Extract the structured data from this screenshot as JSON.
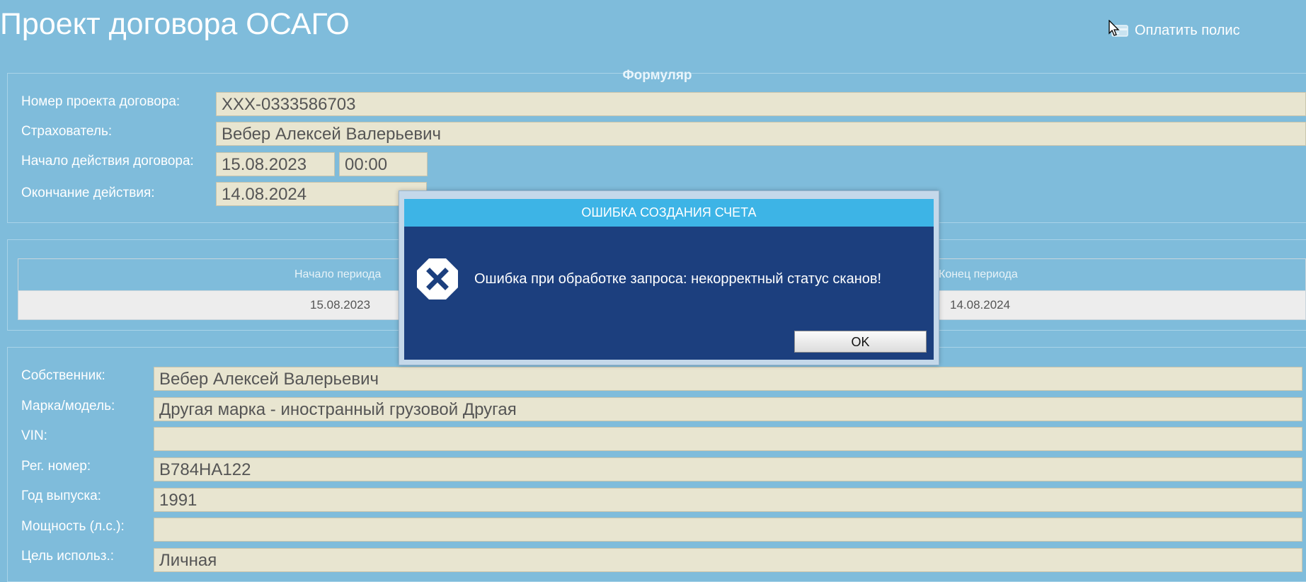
{
  "page": {
    "title": "Проект договора ОСАГО",
    "pay_link_label": "Оплатить полис"
  },
  "formular": {
    "legend": "Формуляр",
    "contract_number_label": "Номер проекта договора:",
    "contract_number": "XXX-0333586703",
    "insurer_label": "Страхователь:",
    "insurer": "Вебер Алексей Валерьевич",
    "start_label": "Начало действия договора:",
    "start_date": "15.08.2023",
    "start_time": "00:00",
    "end_label": "Окончание действия:",
    "end_date": "14.08.2024"
  },
  "periods": {
    "columns": [
      "Начало периода",
      "Конец периода"
    ],
    "rows": [
      [
        "15.08.2023",
        "14.08.2024"
      ]
    ]
  },
  "vehicle": {
    "owner_label": "Собственник:",
    "owner": "Вебер Алексей Валерьевич",
    "model_label": "Марка/модель:",
    "model": "Другая марка - иностранный грузовой Другая",
    "vin_label": "VIN:",
    "vin": "",
    "reg_label": "Рег. номер:",
    "reg": "В784НА122",
    "year_label": "Год выпуска:",
    "year": "1991",
    "power_label": "Мощность (л.с.):",
    "power": "",
    "purpose_label": "Цель использ.:",
    "purpose": "Личная"
  },
  "dialog": {
    "title": "ОШИБКА СОЗДАНИЯ СЧЕТА",
    "message": "Ошибка при обработке запроса: некорректный статус сканов!",
    "ok_label": "OK"
  },
  "colors": {
    "background": "#7fbcdb",
    "field_bg": "#e8e5d0",
    "dialog_title": "#3db4e6",
    "dialog_body": "#1c3f7e"
  },
  "icons": {
    "pay": "credit-card-icon",
    "error": "error-x-icon",
    "cursor": "mouse-cursor-icon"
  }
}
